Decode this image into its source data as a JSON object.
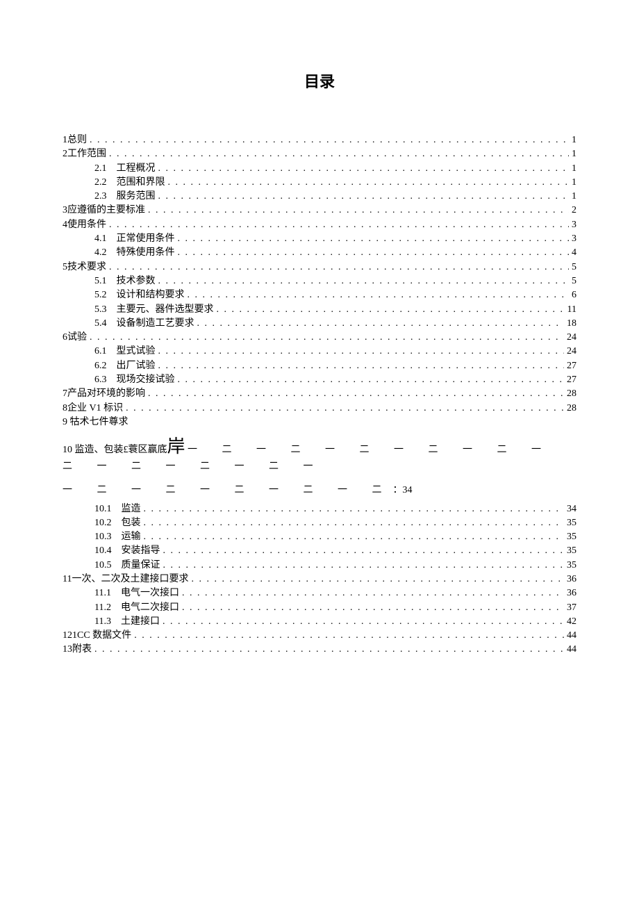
{
  "title": "目录",
  "toc": [
    {
      "level": 0,
      "num": "1",
      "label": "总则",
      "page": "1"
    },
    {
      "level": 0,
      "num": "2",
      "label": "工作范围",
      "page": "1"
    },
    {
      "level": 1,
      "num": "2.1",
      "label": "工程概况",
      "page": "1"
    },
    {
      "level": 1,
      "num": "2.2",
      "label": "范围和界限",
      "page": "1"
    },
    {
      "level": 1,
      "num": "2.3",
      "label": "服务范围",
      "page": "1"
    },
    {
      "level": 0,
      "num": "3",
      "label": "应遵循的主要标准",
      "page": "2"
    },
    {
      "level": 0,
      "num": "4",
      "label": "使用条件",
      "page": "3"
    },
    {
      "level": 1,
      "num": "4.1",
      "label": "正常使用条件",
      "page": "3"
    },
    {
      "level": 1,
      "num": "4.2",
      "label": "特殊使用条件",
      "page": "4"
    },
    {
      "level": 0,
      "num": "5",
      "label": "技术要求",
      "page": "5"
    },
    {
      "level": 1,
      "num": "5.1",
      "label": "技术参数",
      "page": "5"
    },
    {
      "level": 1,
      "num": "5.2",
      "label": "设计和结构要求",
      "page": "6"
    },
    {
      "level": 1,
      "num": "5.3",
      "label": "主要元、器件选型要求",
      "page": "11"
    },
    {
      "level": 1,
      "num": "5.4",
      "label": "设备制造工艺要求",
      "page": "18"
    },
    {
      "level": 0,
      "num": "6",
      "label": "试验",
      "page": "24"
    },
    {
      "level": 1,
      "num": "6.1",
      "label": "型式试验",
      "page": "24"
    },
    {
      "level": 1,
      "num": "6.2",
      "label": "出厂试验",
      "page": "27"
    },
    {
      "level": 1,
      "num": "6.3",
      "label": "现场交接试验",
      "page": "27"
    },
    {
      "level": 0,
      "num": "7",
      "label": "产品对环境的影响",
      "page": "28"
    },
    {
      "level": 0,
      "num": "8",
      "label": "企业 V1 标识",
      "page": "28"
    }
  ],
  "special9": {
    "num": "9",
    "label": "牯术七件尊求"
  },
  "special10": {
    "num": "10",
    "label": "监造、包装£蓑区赢底",
    "big": "岸",
    "dashes1": "一 二 一 二 一 二 一 二 一 二 一 二 一 二 一 二 一 二 一",
    "dashes2": "一 二 一 二 一 二 一 二 一 二",
    "tail": "：34"
  },
  "toc2": [
    {
      "level": 1,
      "num": "10.1",
      "label": "监造",
      "page": "34"
    },
    {
      "level": 1,
      "num": "10.2",
      "label": "包装",
      "page": "35"
    },
    {
      "level": 1,
      "num": "10.3",
      "label": "运输",
      "page": "35"
    },
    {
      "level": 1,
      "num": "10.4",
      "label": "安装指导",
      "page": "35"
    },
    {
      "level": 1,
      "num": "10.5",
      "label": "质量保证",
      "page": "35"
    },
    {
      "level": 0,
      "num": "11",
      "label": "一次、二次及土建接口要求",
      "page": "36"
    },
    {
      "level": 1,
      "num": "11.1",
      "label": "电气一次接口",
      "page": "36"
    },
    {
      "level": 1,
      "num": "11.2",
      "label": "电气二次接口",
      "page": "37"
    },
    {
      "level": 1,
      "num": "11.3",
      "label": "土建接口",
      "page": "42"
    },
    {
      "level": 0,
      "num": "12",
      "label": "1CC 数据文件",
      "page": "44"
    },
    {
      "level": 0,
      "num": "13",
      "label": "附表",
      "page": "44"
    }
  ]
}
